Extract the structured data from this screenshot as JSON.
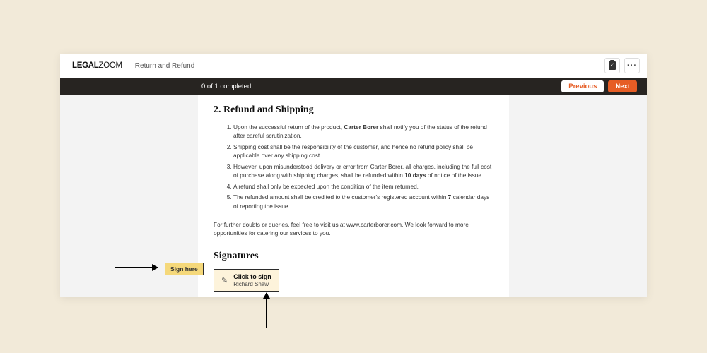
{
  "header": {
    "logo_bold": "LEGAL",
    "logo_light": "ZOOM",
    "doc_title": "Return and Refund"
  },
  "progress": {
    "text": "0 of 1 completed",
    "prev": "Previous",
    "next": "Next"
  },
  "section": {
    "heading": "2. Refund and Shipping",
    "items": [
      {
        "pre": "Upon the successful return of the product, ",
        "bold": "Carter Borer",
        "post": " shall notify you of the status of the refund after careful scrutinization."
      },
      {
        "text": "Shipping cost shall be the responsibility of the customer, and hence no refund policy shall be applicable over any shipping cost."
      },
      {
        "pre": "However, upon misunderstood delivery or error from Carter Borer, all charges, including the full cost of purchase along with shipping charges, shall be refunded within ",
        "bold": "10 days",
        "post": " of notice of the issue."
      },
      {
        "text": "A refund shall only be expected upon the condition of the item returned."
      },
      {
        "pre": "The refunded amount shall be credited to the customer's registered account within ",
        "bold": "7",
        "post": " calendar days of reporting the issue."
      }
    ],
    "outro": "For further doubts or queries, feel free to visit us at www.carterborer.com. We look forward to more opportunities for catering our services to you."
  },
  "signatures": {
    "heading": "Signatures",
    "click_label": "Click to sign",
    "signer_name": "Richard Shaw"
  },
  "sign_here_tag": "Sign here"
}
